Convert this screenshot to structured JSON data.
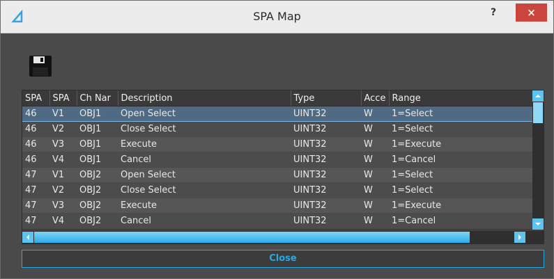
{
  "window": {
    "title": "SPA Map",
    "help_label": "?",
    "close_label": "×"
  },
  "toolbar": {
    "save_icon": "floppy-disk-icon"
  },
  "table": {
    "columns": [
      "SPA",
      "SPA",
      "Ch Nar",
      "Description",
      "Type",
      "Acce",
      "Range"
    ],
    "rows": [
      [
        "46",
        "V1",
        "OBJ1",
        "Open Select",
        "UINT32",
        "W",
        "1=Select"
      ],
      [
        "46",
        "V2",
        "OBJ1",
        "Close Select",
        "UINT32",
        "W",
        "1=Select"
      ],
      [
        "46",
        "V3",
        "OBJ1",
        "Execute",
        "UINT32",
        "W",
        "1=Execute"
      ],
      [
        "46",
        "V4",
        "OBJ1",
        "Cancel",
        "UINT32",
        "W",
        "1=Cancel"
      ],
      [
        "47",
        "V1",
        "OBJ2",
        "Open Select",
        "UINT32",
        "W",
        "1=Select"
      ],
      [
        "47",
        "V2",
        "OBJ2",
        "Close Select",
        "UINT32",
        "W",
        "1=Select"
      ],
      [
        "47",
        "V3",
        "OBJ2",
        "Execute",
        "UINT32",
        "W",
        "1=Execute"
      ],
      [
        "47",
        "V4",
        "OBJ2",
        "Cancel",
        "UINT32",
        "W",
        "1=Cancel"
      ]
    ],
    "selected_row": 0
  },
  "footer": {
    "close_button_label": "Close"
  },
  "colors": {
    "accent": "#29a9e6",
    "close_red": "#c9453e",
    "selected_row": "#4f6a82"
  }
}
